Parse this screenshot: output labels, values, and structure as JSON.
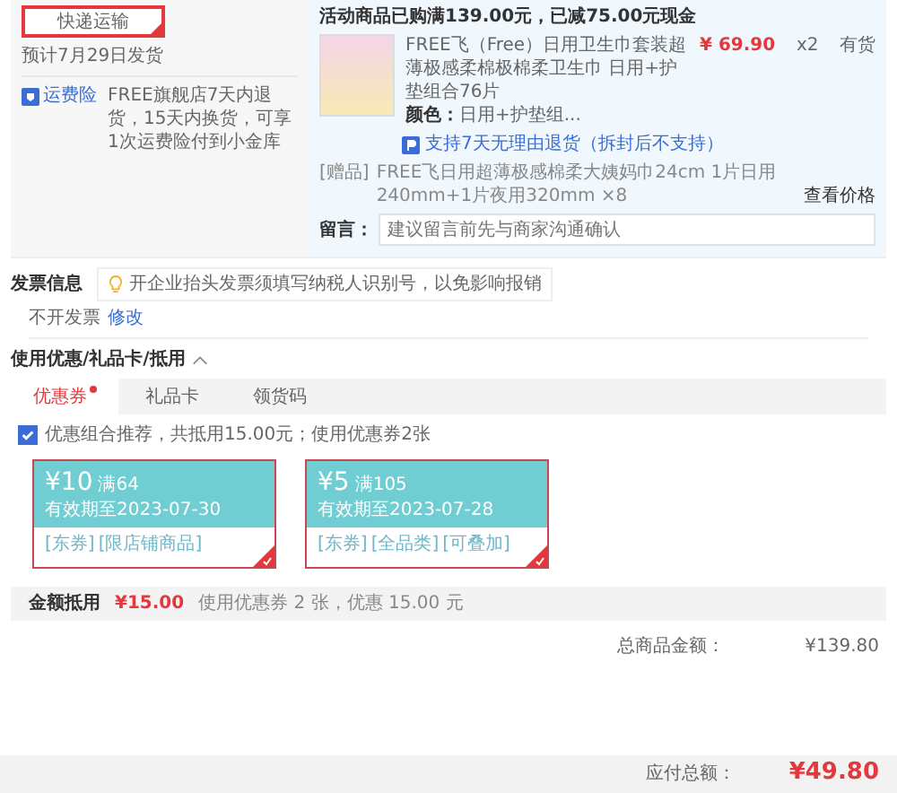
{
  "delivery": {
    "option": {
      "label": "快递运输",
      "selected": true
    },
    "estimate": "预计7月29日发货",
    "insurance": {
      "link": "运费险",
      "text": "FREE旗舰店7天内退货，15天内换货，可享1次运费险付到小金库"
    }
  },
  "order": {
    "promo": "活动商品已购满139.00元，已减75.00元现金",
    "product": {
      "title": "FREE飞（Free）日用卫生巾套装超薄极感柔棉极棉柔卫生巾 日用+护垫组合76片",
      "price": "¥ 69.90",
      "quantity": "x2",
      "stock": "有货",
      "color_label": "颜色：",
      "variant": "日用+护垫组...",
      "return_policy": "支持7天无理由退货（拆封后不支持）"
    },
    "gift": {
      "tag": "[赠品]",
      "text": "FREE飞日用超薄极感棉柔大姨妈巾24cm 1片日用240mm+1片夜用320mm ×8",
      "link": "查看价格"
    },
    "message": {
      "label": "留言：",
      "placeholder": "建议留言前先与商家沟通确认"
    }
  },
  "invoice": {
    "title": "发票信息",
    "tip": "开企业抬头发票须填写纳税人识别号，以免影响报销",
    "status": "不开发票",
    "edit_link": "修改"
  },
  "discounts": {
    "title": "使用优惠/礼品卡/抵用",
    "expanded": true,
    "tabs": [
      {
        "label": "优惠券",
        "selected": true
      },
      {
        "label": "礼品卡",
        "selected": false
      },
      {
        "label": "领货码",
        "selected": false
      }
    ],
    "recommend": {
      "checked": true,
      "text": "优惠组合推荐，共抵用15.00元；使用优惠券2张"
    },
    "coupons": [
      {
        "amount": "¥10",
        "condition": "满64",
        "expiry": "有效期至2023-07-30",
        "tags": [
          "[东券]",
          "[限店铺商品]"
        ],
        "selected": true
      },
      {
        "amount": "¥5",
        "condition": "满105",
        "expiry": "有效期至2023-07-28",
        "tags": [
          "[东券]",
          "[全品类]",
          "[可叠加]"
        ],
        "selected": true
      }
    ],
    "summary": {
      "label": "金额抵用",
      "amount": "¥15.00",
      "text": "使用优惠券 2 张，优惠 15.00 元"
    }
  },
  "totals": [
    {
      "label": "总商品金额：",
      "value": "¥139.80"
    }
  ],
  "payable": {
    "label": "应付总额：",
    "value": "¥49.80"
  }
}
